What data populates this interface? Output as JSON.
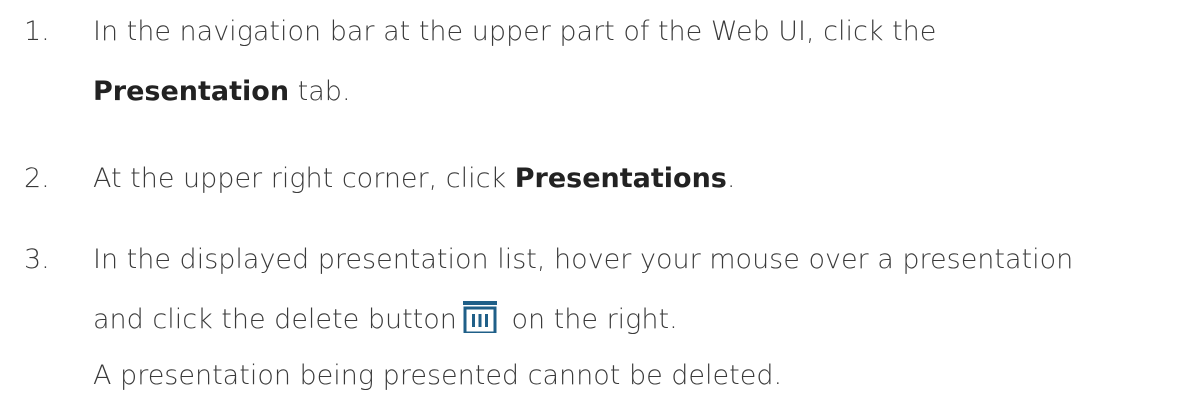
{
  "steps": [
    {
      "number": "1.",
      "line1": "In the navigation bar at the upper part of the Web UI, click the",
      "bold": "Presentation",
      "after_bold": " tab."
    },
    {
      "number": "2.",
      "before_bold": "At the upper right corner, click ",
      "bold": "Presentations",
      "after_bold": "."
    },
    {
      "number": "3.",
      "line1": "In the displayed presentation list, hover your mouse over a presentation",
      "line2_before": "and click the delete button",
      "icon": "trash-can-icon",
      "line2_after": " on the right.",
      "note": "A presentation being presented cannot be deleted."
    }
  ],
  "colors": {
    "text": "#3a3a3a",
    "icon": "#1f5f88"
  }
}
